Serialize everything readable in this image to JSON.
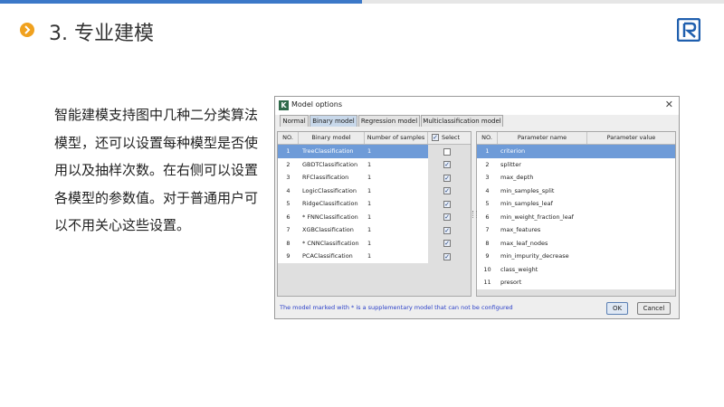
{
  "slide": {
    "title": "3. 专业建模",
    "description": "智能建模支持图中几种二分类算法模型，还可以设置每种模型是否使用以及抽样次数。在右侧可以设置各模型的参数值。对于普通用户可以不用关心这些设置。"
  },
  "dialog": {
    "title": "Model options",
    "tabs": [
      "Normal",
      "Binary model",
      "Regression model",
      "Multiclassification model"
    ],
    "active_tab": "Binary model",
    "left_table": {
      "headers": [
        "NO.",
        "Binary model",
        "Number of samples",
        "Select"
      ],
      "rows": [
        {
          "no": "1",
          "model": "TreeClassification",
          "samples": "1",
          "selected": false
        },
        {
          "no": "2",
          "model": "GBDTClassification",
          "samples": "1",
          "selected": true
        },
        {
          "no": "3",
          "model": "RFClassification",
          "samples": "1",
          "selected": true
        },
        {
          "no": "4",
          "model": "LogicClassification",
          "samples": "1",
          "selected": true
        },
        {
          "no": "5",
          "model": "RidgeClassification",
          "samples": "1",
          "selected": true
        },
        {
          "no": "6",
          "model": "* FNNClassification",
          "samples": "1",
          "selected": true
        },
        {
          "no": "7",
          "model": "XGBClassification",
          "samples": "1",
          "selected": true
        },
        {
          "no": "8",
          "model": "* CNNClassification",
          "samples": "1",
          "selected": true
        },
        {
          "no": "9",
          "model": "PCAClassification",
          "samples": "1",
          "selected": true
        }
      ]
    },
    "right_table": {
      "headers": [
        "NO.",
        "Parameter name",
        "Parameter value"
      ],
      "rows": [
        {
          "no": "1",
          "name": "criterion",
          "value": ""
        },
        {
          "no": "2",
          "name": "splitter",
          "value": ""
        },
        {
          "no": "3",
          "name": "max_depth",
          "value": ""
        },
        {
          "no": "4",
          "name": "min_samples_split",
          "value": ""
        },
        {
          "no": "5",
          "name": "min_samples_leaf",
          "value": ""
        },
        {
          "no": "6",
          "name": "min_weight_fraction_leaf",
          "value": ""
        },
        {
          "no": "7",
          "name": "max_features",
          "value": ""
        },
        {
          "no": "8",
          "name": "max_leaf_nodes",
          "value": ""
        },
        {
          "no": "9",
          "name": "min_impurity_decrease",
          "value": ""
        },
        {
          "no": "10",
          "name": "class_weight",
          "value": ""
        },
        {
          "no": "11",
          "name": "presort",
          "value": ""
        }
      ]
    },
    "footer_message": "The model marked with * is a supplementary model that can not be configured",
    "ok_label": "OK",
    "cancel_label": "Cancel"
  },
  "colors": {
    "accent_blue": "#3b78c8",
    "bullet_orange": "#f0a11e",
    "selected_row": "#6e9bd8",
    "footer_text": "#2a3fc8"
  },
  "icons": {
    "bullet": "chevron-right-circle-icon",
    "logo": "brand-logo-icon",
    "app": "app-k-icon",
    "close": "close-icon"
  }
}
